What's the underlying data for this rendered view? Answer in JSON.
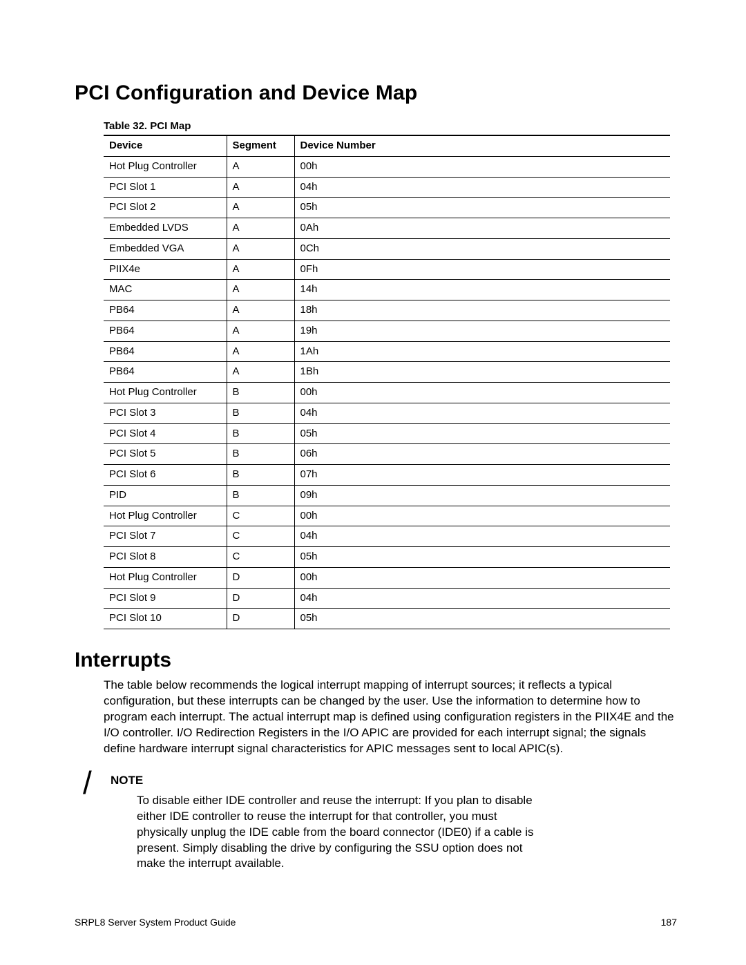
{
  "heading1": "PCI Configuration and Device Map",
  "table": {
    "caption": "Table 32.    PCI Map",
    "headers": {
      "device": "Device",
      "segment": "Segment",
      "number": "Device Number"
    },
    "rows": [
      {
        "device": "Hot Plug Controller",
        "segment": "A",
        "number": "00h"
      },
      {
        "device": "PCI Slot 1",
        "segment": "A",
        "number": "04h"
      },
      {
        "device": "PCI Slot 2",
        "segment": "A",
        "number": "05h"
      },
      {
        "device": "Embedded LVDS",
        "segment": "A",
        "number": "0Ah"
      },
      {
        "device": "Embedded VGA",
        "segment": "A",
        "number": "0Ch"
      },
      {
        "device": "PIIX4e",
        "segment": "A",
        "number": "0Fh"
      },
      {
        "device": "MAC",
        "segment": "A",
        "number": "14h"
      },
      {
        "device": "PB64",
        "segment": "A",
        "number": "18h"
      },
      {
        "device": "PB64",
        "segment": "A",
        "number": "19h"
      },
      {
        "device": "PB64",
        "segment": "A",
        "number": "1Ah"
      },
      {
        "device": "PB64",
        "segment": "A",
        "number": "1Bh"
      },
      {
        "device": "Hot Plug Controller",
        "segment": "B",
        "number": "00h"
      },
      {
        "device": "PCI Slot 3",
        "segment": "B",
        "number": "04h"
      },
      {
        "device": "PCI Slot 4",
        "segment": "B",
        "number": "05h"
      },
      {
        "device": "PCI Slot 5",
        "segment": "B",
        "number": "06h"
      },
      {
        "device": "PCI Slot 6",
        "segment": "B",
        "number": "07h"
      },
      {
        "device": "PID",
        "segment": "B",
        "number": "09h"
      },
      {
        "device": "Hot Plug Controller",
        "segment": "C",
        "number": "00h"
      },
      {
        "device": "PCI Slot 7",
        "segment": "C",
        "number": "04h"
      },
      {
        "device": "PCI Slot 8",
        "segment": "C",
        "number": "05h"
      },
      {
        "device": "Hot Plug Controller",
        "segment": "D",
        "number": "00h"
      },
      {
        "device": "PCI Slot 9",
        "segment": "D",
        "number": "04h"
      },
      {
        "device": "PCI Slot 10",
        "segment": "D",
        "number": "05h"
      }
    ]
  },
  "heading2": "Interrupts",
  "interrupts_paragraph": "The table below recommends the logical interrupt mapping of interrupt sources; it reflects a typical configuration, but these interrupts can be changed by the user.  Use the information to determine how to program each interrupt.  The actual interrupt map is defined using configuration registers in the PIIX4E and the I/O controller.  I/O Redirection Registers in the I/O APIC are provided for each interrupt signal; the signals define hardware interrupt signal characteristics for APIC messages sent to local APIC(s).",
  "note": {
    "slash": "/",
    "heading": "NOTE",
    "text": "To disable either IDE controller and reuse the interrupt: If you plan to disable either IDE controller to reuse the interrupt for that controller, you must physically unplug the IDE cable from the board connector (IDE0) if a cable is present.  Simply disabling the drive by configuring the SSU option does not make the interrupt available."
  },
  "footer": {
    "left": "SRPL8 Server System Product Guide",
    "right": "187"
  }
}
